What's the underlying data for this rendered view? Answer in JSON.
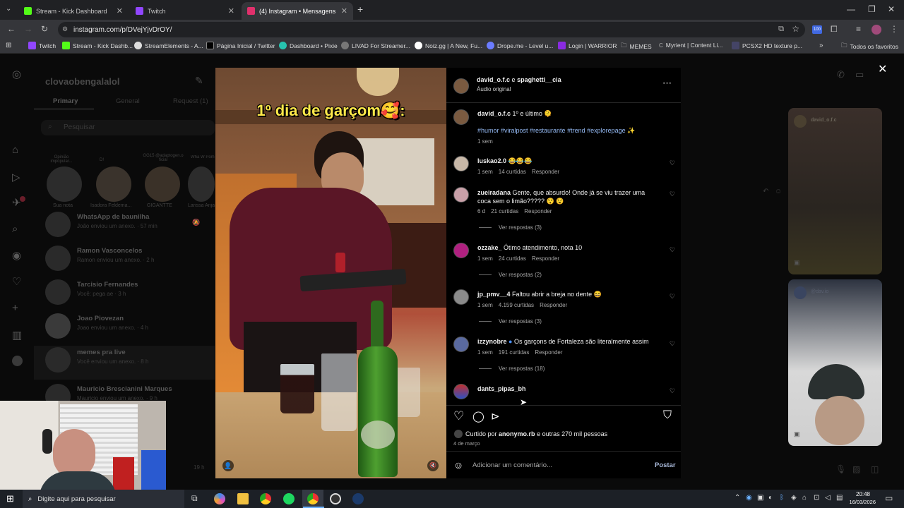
{
  "browser": {
    "tabs": [
      {
        "title": "Stream - Kick Dashboard",
        "color": "#53fc18"
      },
      {
        "title": "Twitch",
        "color": "#9146ff"
      },
      {
        "title": "(4) Instagram • Mensagens",
        "color": "#e1306c"
      }
    ],
    "new_tab": "+",
    "url": "instagram.com/p/DVejYjvDrOY/",
    "extension_badge": "100",
    "bookmarks": [
      "Twitch",
      "Stream - Kick Dashb...",
      "StreamElements - A...",
      "Página Inicial / Twitter",
      "Dashboard • Pixie",
      "LIVAD For Streamer...",
      "Noiz.gg | A New, Fu...",
      "Drope.me - Level u...",
      "Login | WARRIOR",
      "MEMES",
      "Myrient | Content Li...",
      "PCSX2 HD texture p..."
    ],
    "all_bookmarks": "Todos os favoritos"
  },
  "instagram_bg": {
    "username": "clovaobengalalol",
    "tabs": [
      "Primary",
      "General",
      "Request (1)"
    ],
    "search_placeholder": "Pesquisar",
    "stories": [
      {
        "note": "Opinião impopular...",
        "name": "Sua nota"
      },
      {
        "note": "D!",
        "name": "Isadora Feldema..."
      },
      {
        "note": "GG15 @adaptogen.o ficial",
        "name": "GIGANTTE"
      },
      {
        "note": "Wha W Pom...",
        "name": "Larissa Anja..."
      }
    ],
    "chats": [
      {
        "name": "WhatsApp de baunilha",
        "sub": "João enviou um anexo. · 57 min"
      },
      {
        "name": "Ramon Vasconcelos",
        "sub": "Ramon enviou um anexo. · 2 h"
      },
      {
        "name": "Tarcisio Fernandes",
        "sub": "Você: pega ae · 3 h"
      },
      {
        "name": "Joao Piovezan",
        "sub": "Joao enviou um anexo. · 4 h"
      },
      {
        "name": "memes pra live",
        "sub": "Você enviou um anexo. · 8 h"
      },
      {
        "name": "Mauricio Brescianini Marques",
        "sub": "Mauricio enviou um anexo. · 9 h"
      }
    ],
    "last_time": "19 h",
    "right_label_1": "david_o.f.c",
    "right_label_2": "@dav.io"
  },
  "post": {
    "video_caption": "1º dia de garçom🥰:",
    "author": "david_o.f.c",
    "collab_joiner": "e",
    "collab": "spaghetti__cia",
    "audio": "Áudio original",
    "caption_author": "david_o.f.c",
    "caption_text": "1º e último 🫠",
    "hashtags": "#humor #viralpost #restaurante #trend #explorepage ✨",
    "caption_time": "1 sem",
    "comments": [
      {
        "user": "luskao2.0",
        "text": "😂😂😂",
        "time": "1 sem",
        "likes": "14 curtidas",
        "reply": "Responder",
        "replies": ""
      },
      {
        "user": "zueiradana",
        "text": "Gente, que absurdo! Onde já se viu trazer uma coca sem o limão????? 😯 😧",
        "time": "6 d",
        "likes": "21 curtidas",
        "reply": "Responder",
        "replies": "Ver respostas (3)"
      },
      {
        "user": "ozzake_",
        "text": "Ótimo atendimento, nota 10",
        "time": "1 sem",
        "likes": "24 curtidas",
        "reply": "Responder",
        "replies": "Ver respostas (2)"
      },
      {
        "user": "jp_pmv__4",
        "text": "Faltou abrir a breja no dente 😆",
        "time": "1 sem",
        "likes": "4.159 curtidas",
        "reply": "Responder",
        "replies": "Ver respostas (3)"
      },
      {
        "user": "izzynobre",
        "text": "Os garçons de Fortaleza são literalmente assim",
        "time": "1 sem",
        "likes": "191 curtidas",
        "reply": "Responder",
        "replies": "Ver respostas (18)"
      },
      {
        "user": "dants_pipas_bh",
        "text": "",
        "time": "",
        "likes": "",
        "reply": "",
        "replies": ""
      }
    ],
    "liked_prefix": "Curtido por",
    "liked_user": "anonymo.rb",
    "liked_suffix": "e outras 270 mil pessoas",
    "date": "4 de março",
    "comment_placeholder": "Adicionar um comentário...",
    "post_button": "Postar"
  },
  "taskbar": {
    "search": "Digite aqui para pesquisar",
    "time": "20:48",
    "date": "16/03/2026"
  }
}
